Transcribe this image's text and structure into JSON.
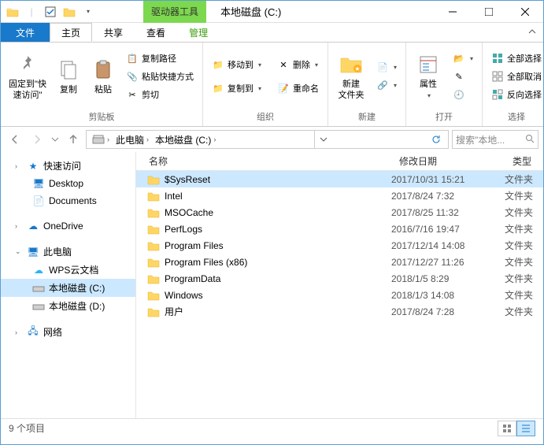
{
  "title_bar": {
    "tool_tab": "驱动器工具",
    "title": "本地磁盘 (C:)"
  },
  "tabs": {
    "file": "文件",
    "home": "主页",
    "share": "共享",
    "view": "查看",
    "manage": "管理"
  },
  "ribbon": {
    "pin": "固定到\"快速访问\"",
    "copy": "复制",
    "paste": "粘贴",
    "copy_path": "复制路径",
    "paste_shortcut": "粘贴快捷方式",
    "cut": "剪切",
    "clipboard_group": "剪贴板",
    "move_to": "移动到",
    "copy_to": "复制到",
    "delete": "删除",
    "rename": "重命名",
    "organize_group": "组织",
    "new_folder": "新建\n文件夹",
    "new_group": "新建",
    "properties": "属性",
    "open_group": "打开",
    "select_all": "全部选择",
    "select_none": "全部取消",
    "invert_selection": "反向选择",
    "select_group": "选择"
  },
  "breadcrumb": {
    "this_pc": "此电脑",
    "drive": "本地磁盘 (C:)"
  },
  "search": {
    "placeholder": "搜索\"本地..."
  },
  "sidebar": {
    "quick_access": "快速访问",
    "desktop": "Desktop",
    "documents": "Documents",
    "onedrive": "OneDrive",
    "this_pc": "此电脑",
    "wps": "WPS云文档",
    "drive_c": "本地磁盘 (C:)",
    "drive_d": "本地磁盘 (D:)",
    "network": "网络"
  },
  "columns": {
    "name": "名称",
    "date": "修改日期",
    "type": "类型"
  },
  "files": [
    {
      "name": "$SysReset",
      "date": "2017/10/31 15:21",
      "type": "文件夹",
      "selected": true
    },
    {
      "name": "Intel",
      "date": "2017/8/24 7:32",
      "type": "文件夹"
    },
    {
      "name": "MSOCache",
      "date": "2017/8/25 11:32",
      "type": "文件夹"
    },
    {
      "name": "PerfLogs",
      "date": "2016/7/16 19:47",
      "type": "文件夹"
    },
    {
      "name": "Program Files",
      "date": "2017/12/14 14:08",
      "type": "文件夹"
    },
    {
      "name": "Program Files (x86)",
      "date": "2017/12/27 11:26",
      "type": "文件夹"
    },
    {
      "name": "ProgramData",
      "date": "2018/1/5 8:29",
      "type": "文件夹"
    },
    {
      "name": "Windows",
      "date": "2018/1/3 14:08",
      "type": "文件夹"
    },
    {
      "name": "用户",
      "date": "2017/8/24 7:28",
      "type": "文件夹"
    }
  ],
  "status": {
    "count": "9 个项目"
  }
}
